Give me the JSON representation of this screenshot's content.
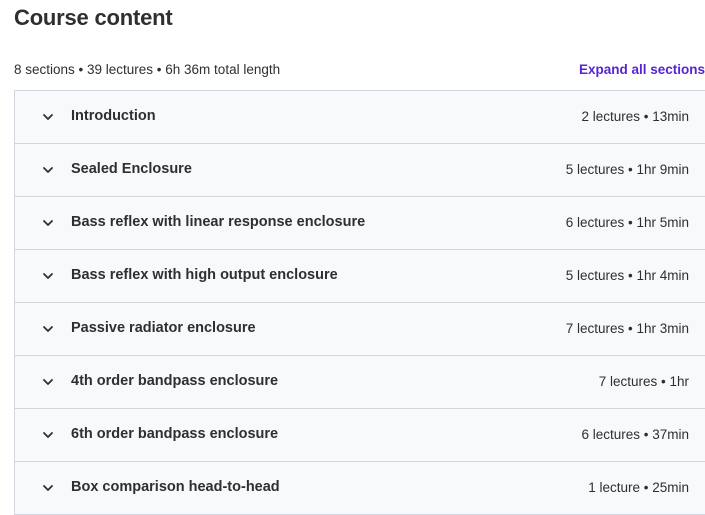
{
  "header": {
    "title": "Course content",
    "summary": "8 sections • 39 lectures • 6h 36m total length",
    "expand_label": "Expand all sections"
  },
  "sections": [
    {
      "title": "Introduction",
      "meta": "2 lectures • 13min"
    },
    {
      "title": "Sealed Enclosure",
      "meta": "5 lectures • 1hr 9min"
    },
    {
      "title": "Bass reflex with linear response enclosure",
      "meta": "6 lectures • 1hr 5min"
    },
    {
      "title": "Bass reflex with high output enclosure",
      "meta": "5 lectures • 1hr 4min"
    },
    {
      "title": "Passive radiator enclosure",
      "meta": "7 lectures • 1hr 3min"
    },
    {
      "title": "4th order bandpass enclosure",
      "meta": "7 lectures • 1hr"
    },
    {
      "title": "6th order bandpass enclosure",
      "meta": "6 lectures • 37min"
    },
    {
      "title": "Box comparison head-to-head",
      "meta": "1 lecture • 25min"
    }
  ],
  "icons": {
    "section_toggle": "chevron-down-icon"
  },
  "colors": {
    "accent": "#5624d0",
    "text": "#2d2f31",
    "row_bg": "#f7f9fa",
    "border": "#d1d7dc"
  }
}
